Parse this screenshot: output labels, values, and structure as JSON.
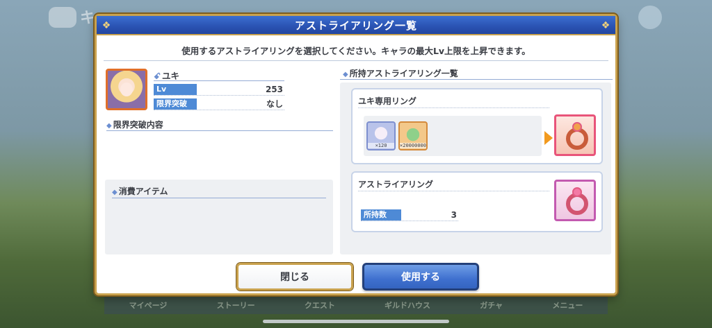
{
  "background": {
    "bottom_nav": [
      "マイページ",
      "クエスト",
      "ストーリー",
      "クエスト",
      "ギルドハウス",
      "ガチャ",
      "メニュー"
    ]
  },
  "dialog": {
    "title": "アストライアリング一覧",
    "instruction": "使用するアストライアリングを選択してください。キャラの最大Lv上限を上昇できます。",
    "character": {
      "name": "ユキ",
      "name_mark": "ꗃ",
      "stats": [
        {
          "label": "Lv",
          "value": "253"
        },
        {
          "label": "限界突破",
          "value": "なし"
        }
      ]
    },
    "limit_break_section": "限界突破内容",
    "consume_section": "消費アイテム",
    "ring_list_section": "所持アストライアリング一覧",
    "cards": [
      {
        "title": "ユキ専用リング",
        "costs": [
          {
            "icon": "yuki-memory-piece-icon",
            "qty": "×120"
          },
          {
            "icon": "mana-pile-icon",
            "qty": "×20000000"
          }
        ],
        "ring_icon": "yuki-exclusive-ring-icon"
      },
      {
        "title": "アストライアリング",
        "owned_label": "所持数",
        "owned_value": "3",
        "ring_icon": "astraea-ring-icon"
      }
    ],
    "buttons": {
      "close": "閉じる",
      "use": "使用する"
    }
  },
  "colors": {
    "title_bar": "#2a52b2",
    "frame_gold": "#c9a24e",
    "stat_label": "#4e8ad6",
    "arrow": "#f29a1e"
  }
}
